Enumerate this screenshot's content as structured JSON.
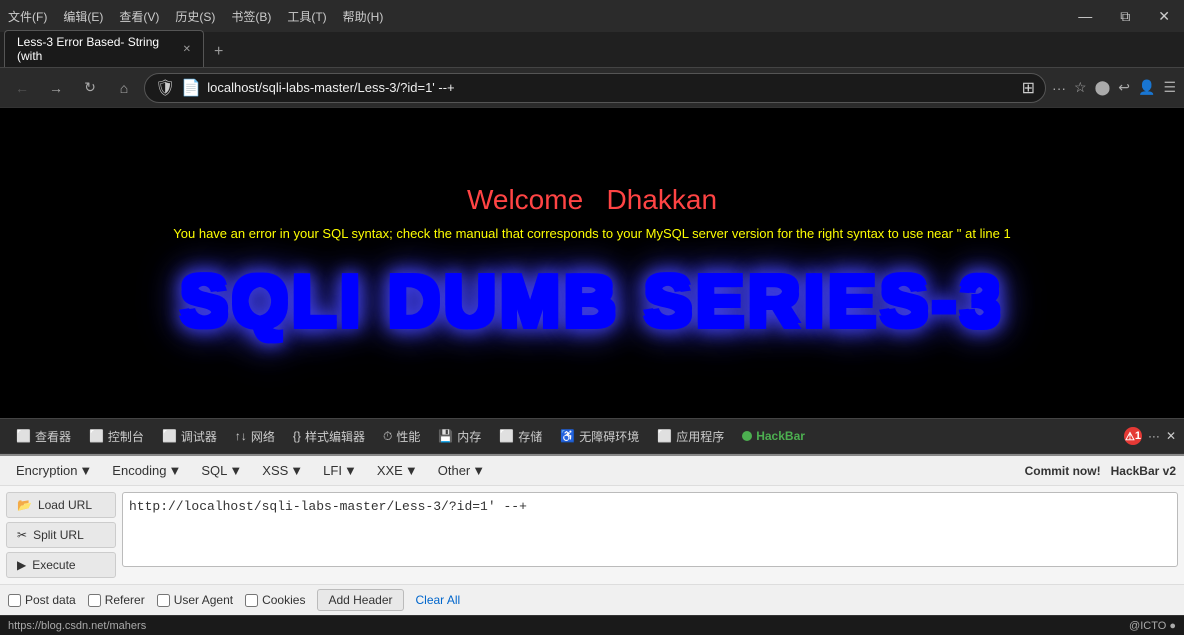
{
  "titlebar": {
    "menu_items": [
      "文件(F)",
      "编辑(E)",
      "查看(V)",
      "历史(S)",
      "书签(B)",
      "工具(T)",
      "帮助(H)"
    ],
    "min_label": "—",
    "restore_label": "⧉",
    "close_label": "✕"
  },
  "tabs": {
    "active_tab": "Less-3 Error Based- String (with",
    "new_tab_icon": "+"
  },
  "addressbar": {
    "back_icon": "←",
    "forward_icon": "→",
    "reload_icon": "↻",
    "home_icon": "⌂",
    "url": "localhost/sqli-labs-master/Less-3/?id=1' --+",
    "shield_icon": "🛡",
    "bookmark_icon": "☆",
    "more_icon": "···"
  },
  "main": {
    "welcome": "Welcome",
    "welcome_name": "Dhakkan",
    "error_text": "You have an error in your SQL syntax; check the manual that corresponds to your MySQL server version for the right syntax to use near '' at line 1",
    "sqli_logo": "SQLI DUMB SERIES-3"
  },
  "devtools": {
    "items": [
      {
        "icon": "⬜",
        "label": "查看器"
      },
      {
        "icon": "⬜",
        "label": "控制台"
      },
      {
        "icon": "⬜",
        "label": "调试器"
      },
      {
        "icon": "↑↓",
        "label": "网络"
      },
      {
        "icon": "{}",
        "label": "样式编辑器"
      },
      {
        "icon": "⏱",
        "label": "性能"
      },
      {
        "icon": "💾",
        "label": "内存"
      },
      {
        "icon": "⬜",
        "label": "存储"
      },
      {
        "icon": "⬆",
        "label": "无障碍环境"
      },
      {
        "icon": "⬜",
        "label": "应用程序"
      },
      {
        "icon": "HackBar",
        "label": "HackBar",
        "is_hackbar": true
      }
    ],
    "error_count": "1",
    "more_icon": "···",
    "close_icon": "✕"
  },
  "hackbar": {
    "menu": [
      {
        "label": "Encryption",
        "has_arrow": true
      },
      {
        "label": "Encoding",
        "has_arrow": true
      },
      {
        "label": "SQL",
        "has_arrow": true
      },
      {
        "label": "XSS",
        "has_arrow": true
      },
      {
        "label": "LFI",
        "has_arrow": true
      },
      {
        "label": "XXE",
        "has_arrow": true
      },
      {
        "label": "Other",
        "has_arrow": true
      }
    ],
    "commit_label": "Commit now!",
    "commit_version": "HackBar v2",
    "load_url_label": "Load URL",
    "split_url_label": "Split URL",
    "execute_label": "Execute",
    "url_value": "http://localhost/sqli-labs-master/Less-3/?id=1' --+",
    "checkboxes": [
      {
        "label": "Post data",
        "checked": false
      },
      {
        "label": "Referer",
        "checked": false
      },
      {
        "label": "User Agent",
        "checked": false
      },
      {
        "label": "Cookies",
        "checked": false
      }
    ],
    "add_header_label": "Add Header",
    "clear_all_label": "Clear All"
  },
  "statusbar": {
    "url": "https://blog.csdn.net/mahers",
    "right_text": "@ICTO ●"
  }
}
